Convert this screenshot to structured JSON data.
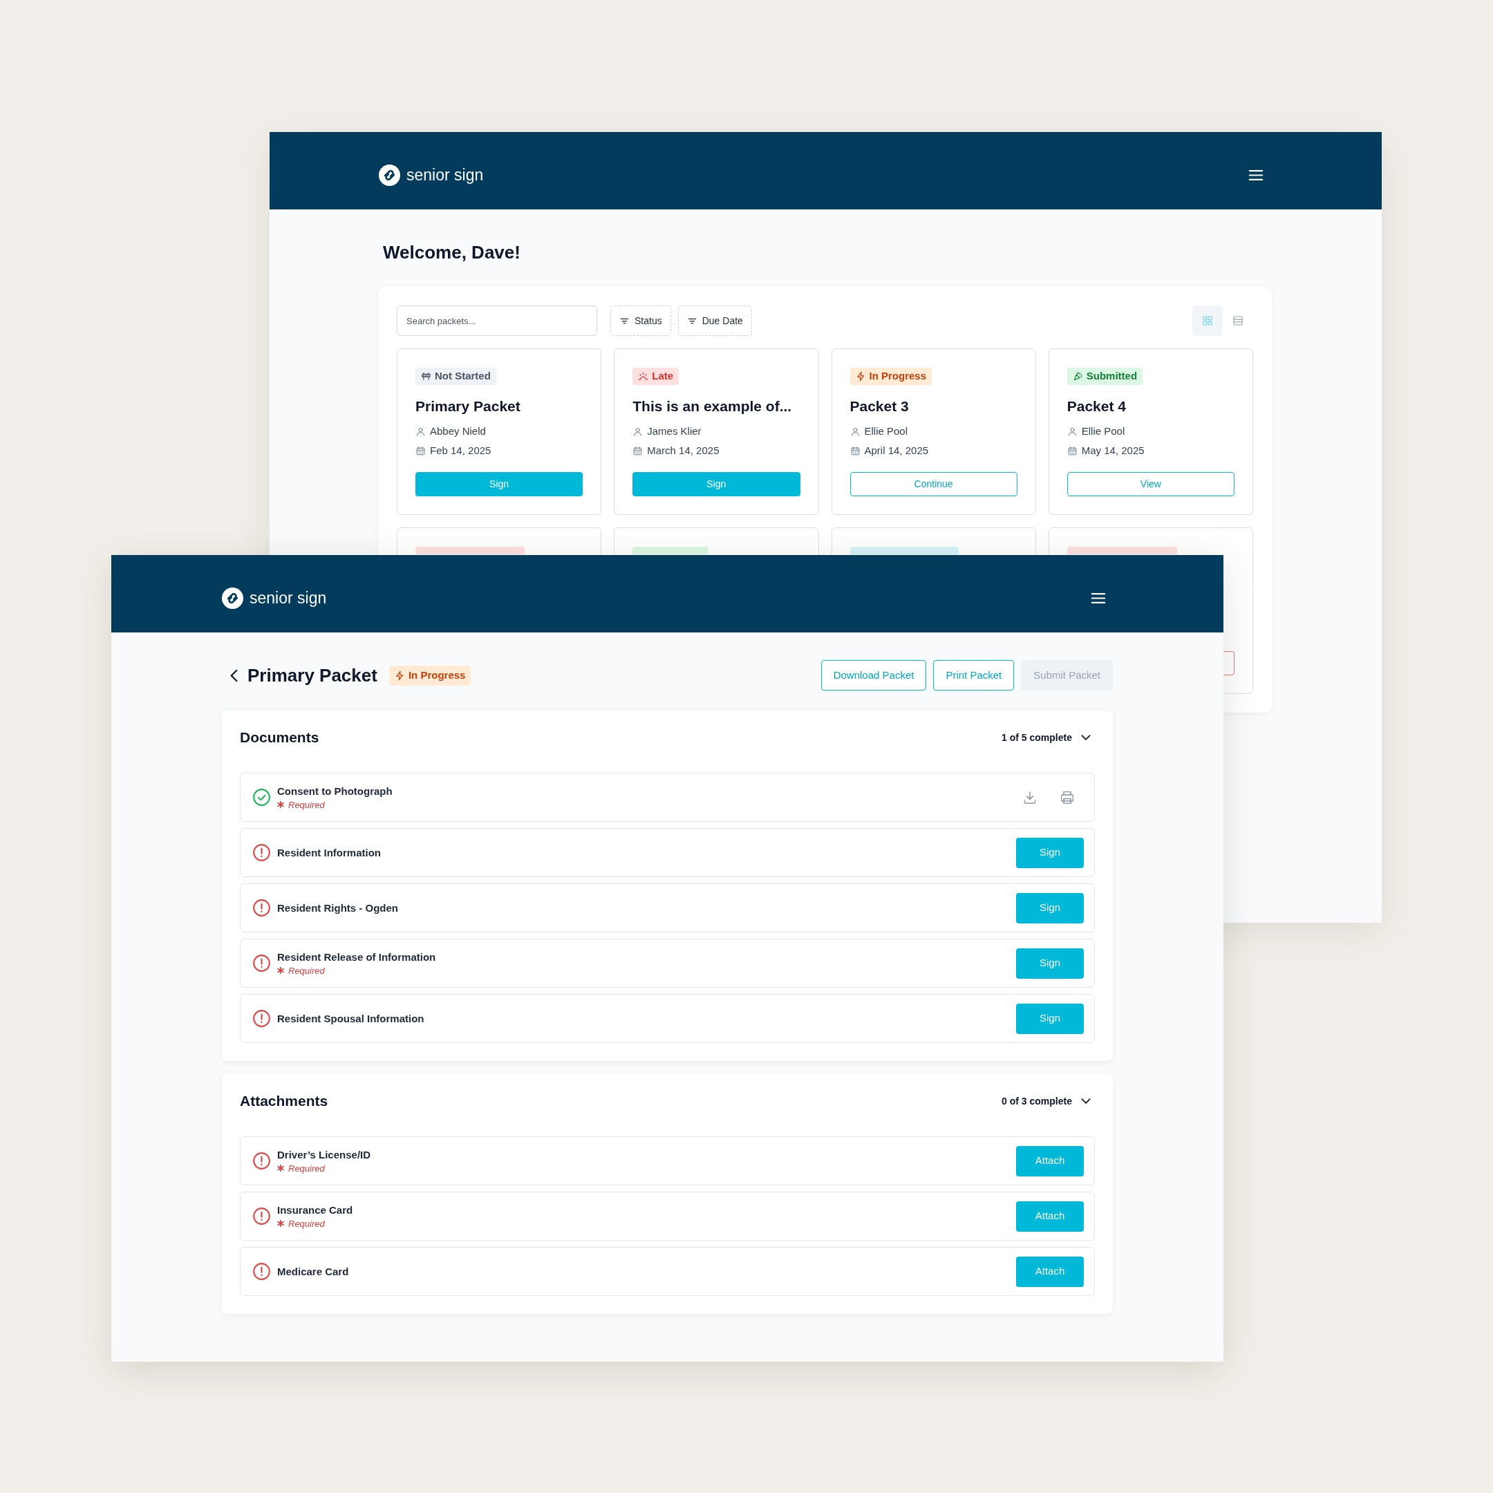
{
  "back_window": {
    "brand": "senior sign",
    "greeting": "Welcome, Dave!",
    "search": {
      "placeholder": "Search packets..."
    },
    "filters": [
      "Status",
      "Due Date"
    ],
    "views": [
      {
        "kind": "grid",
        "selected": true
      },
      {
        "kind": "list",
        "selected": false
      }
    ],
    "cards": [
      {
        "status": {
          "kind": "idle",
          "label": "Not Started"
        },
        "title": "Primary Packet",
        "person": "Abbey Nield",
        "date": "Feb 14, 2025",
        "button": {
          "kind": "filled",
          "label": "Sign"
        }
      },
      {
        "status": {
          "kind": "late",
          "label": "Late"
        },
        "title": "This is an example of...",
        "person": "James Klier",
        "date": "March 14, 2025",
        "button": {
          "kind": "filled",
          "label": "Sign"
        }
      },
      {
        "status": {
          "kind": "progress",
          "label": "In Progress"
        },
        "title": "Packet 3",
        "person": "Ellie Pool",
        "date": "April 14, 2025",
        "button": {
          "kind": "outline",
          "label": "Continue"
        }
      },
      {
        "status": {
          "kind": "submitted",
          "label": "Submitted"
        },
        "title": "Packet 4",
        "person": "Ellie Pool",
        "date": "May 14, 2025",
        "button": {
          "kind": "outline",
          "label": "View"
        }
      },
      {
        "status": {
          "kind": "ready"
        }
      },
      {
        "status": {
          "kind": "approved"
        }
      },
      {
        "status": {
          "kind": "paper"
        }
      },
      {
        "status": {
          "kind": "declined"
        },
        "button": {
          "kind": "danger"
        }
      }
    ]
  },
  "front_window": {
    "brand": "senior sign",
    "title": "Primary Packet",
    "status": {
      "kind": "progress",
      "label": "In Progress"
    },
    "actions": [
      {
        "label": "Download Packet",
        "disabled": false
      },
      {
        "label": "Print Packet",
        "disabled": false
      },
      {
        "label": "Submit Packet",
        "disabled": true
      }
    ],
    "sections": [
      {
        "title": "Documents",
        "progress": "1 of 5 complete",
        "expanded": true,
        "items": [
          {
            "name": "Consent to Photograph",
            "note": "Required",
            "complete": true
          },
          {
            "name": "Resident Information",
            "complete": false,
            "action": "Sign"
          },
          {
            "name": "Resident Rights - Ogden",
            "complete": false,
            "action": "Sign"
          },
          {
            "name": "Resident Release of Information",
            "note": "Required",
            "complete": false,
            "action": "Sign"
          },
          {
            "name": "Resident Spousal Information",
            "complete": false,
            "action": "Sign"
          }
        ]
      },
      {
        "title": "Attachments",
        "progress": "0 of 3 complete",
        "expanded": true,
        "items": [
          {
            "name": "Driver’s License/ID",
            "note": "Required",
            "complete": false,
            "action": "Attach"
          },
          {
            "name": "Insurance Card",
            "note": "Required",
            "complete": false,
            "action": "Attach"
          },
          {
            "name": "Medicare Card",
            "complete": false,
            "action": "Attach"
          }
        ]
      }
    ]
  }
}
